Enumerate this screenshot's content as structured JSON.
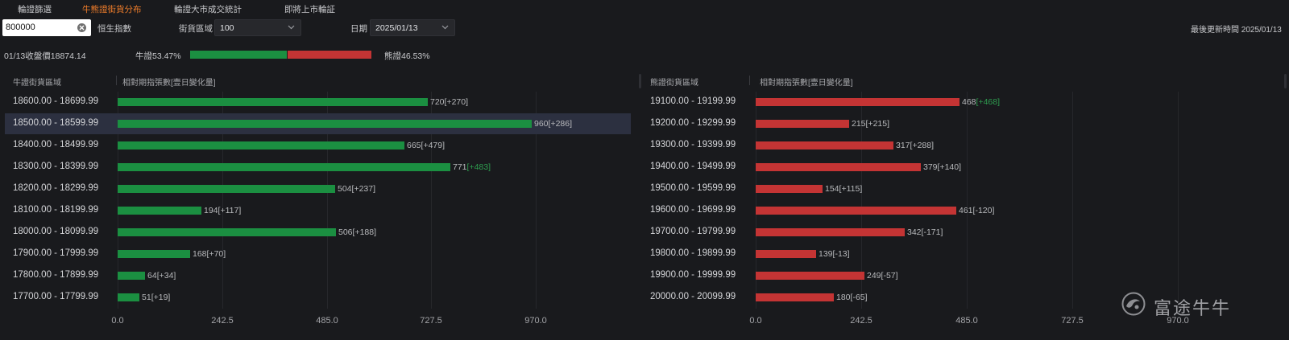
{
  "tabs": [
    {
      "label": "輪證篩選",
      "active": false
    },
    {
      "label": "牛熊證街貨分布",
      "active": true
    },
    {
      "label": "輪證大市成交統計",
      "active": false
    },
    {
      "label": "即將上市輪証",
      "active": false
    }
  ],
  "toolbar": {
    "code_value": "800000",
    "index_name": "恒生指數",
    "range_label": "街貨區域",
    "range_value": "100",
    "date_label": "日期",
    "date_value": "2025/01/13",
    "update_text": "最後更新時間 2025/01/13"
  },
  "summary": {
    "close_text": "01/13收盤價18874.14",
    "bull_text": "牛證53.47%",
    "bear_text": "熊證46.53%",
    "bull_pct": 53.47,
    "bear_pct": 46.53
  },
  "colors": {
    "bull": "#1b8f41",
    "bear": "#c43434",
    "accent": "#f07d2a",
    "delta_positive": "#2e9d4f"
  },
  "chart_data": [
    {
      "type": "bar",
      "orientation": "horizontal",
      "header_range": "牛證街貨區域",
      "header_value": "相對期指張數[壹日變化量]",
      "xlim": [
        0,
        970
      ],
      "x_ticks": [
        "0.0",
        "242.5",
        "485.0",
        "727.5",
        "970.0"
      ],
      "selected_index": 1,
      "rows": [
        {
          "range": "18600.00 - 18699.99",
          "value": 720,
          "delta": "[+270]",
          "delta_highlight": false
        },
        {
          "range": "18500.00 - 18599.99",
          "value": 960,
          "delta": "[+286]",
          "delta_highlight": false
        },
        {
          "range": "18400.00 - 18499.99",
          "value": 665,
          "delta": "[+479]",
          "delta_highlight": false
        },
        {
          "range": "18300.00 - 18399.99",
          "value": 771,
          "delta": "[+483]",
          "delta_highlight": true
        },
        {
          "range": "18200.00 - 18299.99",
          "value": 504,
          "delta": "[+237]",
          "delta_highlight": false
        },
        {
          "range": "18100.00 - 18199.99",
          "value": 194,
          "delta": "[+117]",
          "delta_highlight": false
        },
        {
          "range": "18000.00 - 18099.99",
          "value": 506,
          "delta": "[+188]",
          "delta_highlight": false
        },
        {
          "range": "17900.00 - 17999.99",
          "value": 168,
          "delta": "[+70]",
          "delta_highlight": false
        },
        {
          "range": "17800.00 - 17899.99",
          "value": 64,
          "delta": "[+34]",
          "delta_highlight": false
        },
        {
          "range": "17700.00 - 17799.99",
          "value": 51,
          "delta": "[+19]",
          "delta_highlight": false
        }
      ]
    },
    {
      "type": "bar",
      "orientation": "horizontal",
      "header_range": "熊證街貨區域",
      "header_value": "相對期指張數[壹日變化量]",
      "xlim": [
        0,
        970
      ],
      "x_ticks": [
        "0.0",
        "242.5",
        "485.0",
        "727.5",
        "970.0"
      ],
      "selected_index": -1,
      "rows": [
        {
          "range": "19100.00 - 19199.99",
          "value": 468,
          "delta": "[+468]",
          "delta_highlight": true
        },
        {
          "range": "19200.00 - 19299.99",
          "value": 215,
          "delta": "[+215]",
          "delta_highlight": false
        },
        {
          "range": "19300.00 - 19399.99",
          "value": 317,
          "delta": "[+288]",
          "delta_highlight": false
        },
        {
          "range": "19400.00 - 19499.99",
          "value": 379,
          "delta": "[+140]",
          "delta_highlight": false
        },
        {
          "range": "19500.00 - 19599.99",
          "value": 154,
          "delta": "[+115]",
          "delta_highlight": false
        },
        {
          "range": "19600.00 - 19699.99",
          "value": 461,
          "delta": "[-120]",
          "delta_highlight": false
        },
        {
          "range": "19700.00 - 19799.99",
          "value": 342,
          "delta": "[-171]",
          "delta_highlight": false
        },
        {
          "range": "19800.00 - 19899.99",
          "value": 139,
          "delta": "[-13]",
          "delta_highlight": false
        },
        {
          "range": "19900.00 - 19999.99",
          "value": 249,
          "delta": "[-57]",
          "delta_highlight": false
        },
        {
          "range": "20000.00 - 20099.99",
          "value": 180,
          "delta": "[-65]",
          "delta_highlight": false
        }
      ]
    }
  ],
  "watermark": {
    "text": "富途牛牛",
    "icon": "futu-logo-icon"
  }
}
